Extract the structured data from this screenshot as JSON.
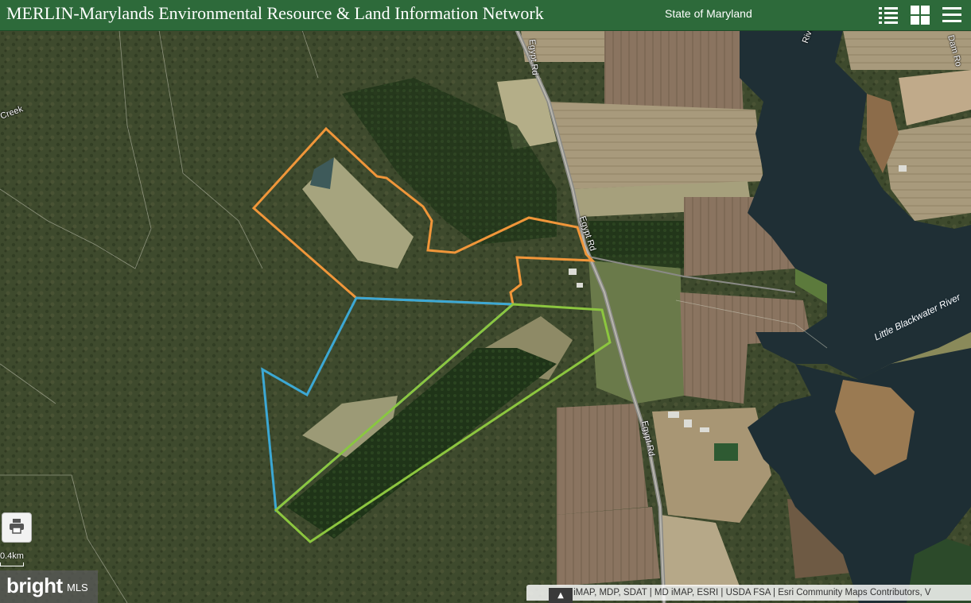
{
  "header": {
    "title": "MERLIN-Marylands Environmental Resource & Land Information Network",
    "state_label": "State of Maryland",
    "icons": [
      "list-icon",
      "grid-icon",
      "menu-icon"
    ],
    "background_color": "#2d6a3a"
  },
  "map": {
    "road_labels": [
      "Egypt Rd",
      "Egypt Rd",
      "Egypt Rd",
      "Creek",
      "Dam Ro",
      "River"
    ],
    "water_labels": [
      "Little Blackwater River"
    ],
    "parcel_outline_colors": [
      "#f0963a",
      "#3ca8d4",
      "#8cc63f"
    ]
  },
  "controls": {
    "print_icon": "printer-icon",
    "scale_label": "0.4km"
  },
  "branding": {
    "main": "bright",
    "suffix": "MLS"
  },
  "attribution": {
    "text": "MD iMAP, MDP, SDAT | MD iMAP, ESRI | USDA FSA | Esri Community Maps Contributors, V",
    "toggle_icon": "caret-up-icon"
  }
}
